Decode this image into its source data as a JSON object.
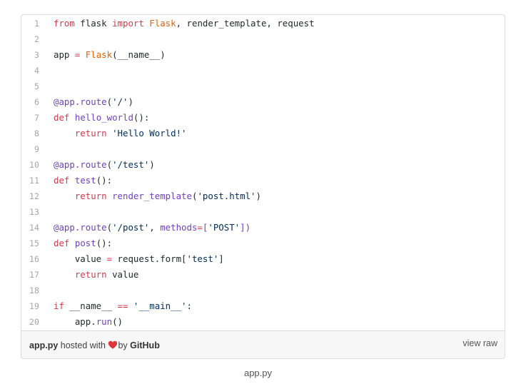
{
  "gist": {
    "lines": [
      {
        "n": "1",
        "tokens": [
          {
            "t": "kw",
            "v": "from"
          },
          {
            "t": "",
            "v": " flask "
          },
          {
            "t": "kw",
            "v": "import"
          },
          {
            "t": "",
            "v": " "
          },
          {
            "t": "cls",
            "v": "Flask"
          },
          {
            "t": "",
            "v": ", render_template, request"
          }
        ]
      },
      {
        "n": "2",
        "tokens": []
      },
      {
        "n": "3",
        "tokens": [
          {
            "t": "",
            "v": "app "
          },
          {
            "t": "kw",
            "v": "="
          },
          {
            "t": "",
            "v": " "
          },
          {
            "t": "cls",
            "v": "Flask"
          },
          {
            "t": "",
            "v": "(__name__)"
          }
        ]
      },
      {
        "n": "4",
        "tokens": []
      },
      {
        "n": "5",
        "tokens": []
      },
      {
        "n": "6",
        "tokens": [
          {
            "t": "fn",
            "v": "@app.route"
          },
          {
            "t": "",
            "v": "("
          },
          {
            "t": "str",
            "v": "'/'"
          },
          {
            "t": "",
            "v": ")"
          }
        ]
      },
      {
        "n": "7",
        "tokens": [
          {
            "t": "kw",
            "v": "def"
          },
          {
            "t": "",
            "v": " "
          },
          {
            "t": "fn",
            "v": "hello_world"
          },
          {
            "t": "",
            "v": "():"
          }
        ]
      },
      {
        "n": "8",
        "tokens": [
          {
            "t": "",
            "v": "    "
          },
          {
            "t": "kw",
            "v": "return"
          },
          {
            "t": "",
            "v": " "
          },
          {
            "t": "str",
            "v": "'Hello World!'"
          }
        ]
      },
      {
        "n": "9",
        "tokens": []
      },
      {
        "n": "10",
        "tokens": [
          {
            "t": "fn",
            "v": "@app.route"
          },
          {
            "t": "",
            "v": "("
          },
          {
            "t": "str",
            "v": "'/test'"
          },
          {
            "t": "",
            "v": ")"
          }
        ]
      },
      {
        "n": "11",
        "tokens": [
          {
            "t": "kw",
            "v": "def"
          },
          {
            "t": "",
            "v": " "
          },
          {
            "t": "fn",
            "v": "test"
          },
          {
            "t": "",
            "v": "():"
          }
        ]
      },
      {
        "n": "12",
        "tokens": [
          {
            "t": "",
            "v": "    "
          },
          {
            "t": "kw",
            "v": "return"
          },
          {
            "t": "",
            "v": " "
          },
          {
            "t": "fn",
            "v": "render_template"
          },
          {
            "t": "",
            "v": "("
          },
          {
            "t": "str",
            "v": "'post.html'"
          },
          {
            "t": "",
            "v": ")"
          }
        ]
      },
      {
        "n": "13",
        "tokens": []
      },
      {
        "n": "14",
        "tokens": [
          {
            "t": "fn",
            "v": "@app.route"
          },
          {
            "t": "",
            "v": "("
          },
          {
            "t": "str",
            "v": "'/post'"
          },
          {
            "t": "",
            "v": ", "
          },
          {
            "t": "fn",
            "v": "methods"
          },
          {
            "t": "kw",
            "v": "="
          },
          {
            "t": "fn",
            "v": "["
          },
          {
            "t": "str",
            "v": "'POST'"
          },
          {
            "t": "fn",
            "v": "])"
          }
        ]
      },
      {
        "n": "15",
        "tokens": [
          {
            "t": "kw",
            "v": "def"
          },
          {
            "t": "",
            "v": " "
          },
          {
            "t": "fn",
            "v": "post"
          },
          {
            "t": "",
            "v": "():"
          }
        ]
      },
      {
        "n": "16",
        "tokens": [
          {
            "t": "",
            "v": "    value "
          },
          {
            "t": "kw",
            "v": "="
          },
          {
            "t": "",
            "v": " request.form["
          },
          {
            "t": "str",
            "v": "'test'"
          },
          {
            "t": "",
            "v": "]"
          }
        ]
      },
      {
        "n": "17",
        "tokens": [
          {
            "t": "",
            "v": "    "
          },
          {
            "t": "kw",
            "v": "return"
          },
          {
            "t": "",
            "v": " value"
          }
        ]
      },
      {
        "n": "18",
        "tokens": []
      },
      {
        "n": "19",
        "tokens": [
          {
            "t": "kw",
            "v": "if"
          },
          {
            "t": "",
            "v": " __name__ "
          },
          {
            "t": "kw",
            "v": "=="
          },
          {
            "t": "",
            "v": " "
          },
          {
            "t": "str",
            "v": "'__main__'"
          },
          {
            "t": "",
            "v": ":"
          }
        ]
      },
      {
        "n": "20",
        "tokens": [
          {
            "t": "",
            "v": "    app."
          },
          {
            "t": "fn",
            "v": "run"
          },
          {
            "t": "",
            "v": "()"
          }
        ]
      }
    ],
    "footer": {
      "filename": "app.py",
      "hosted_with": " hosted with ",
      "by": "by ",
      "github": "GitHub",
      "view_raw": "view raw",
      "heart_icon": "heart-icon"
    }
  },
  "caption": "app.py",
  "colors": {
    "keyword": "#d73a49",
    "class": "#e36209",
    "function": "#6f42c1",
    "string": "#032f62",
    "heart": "#e0363b"
  }
}
